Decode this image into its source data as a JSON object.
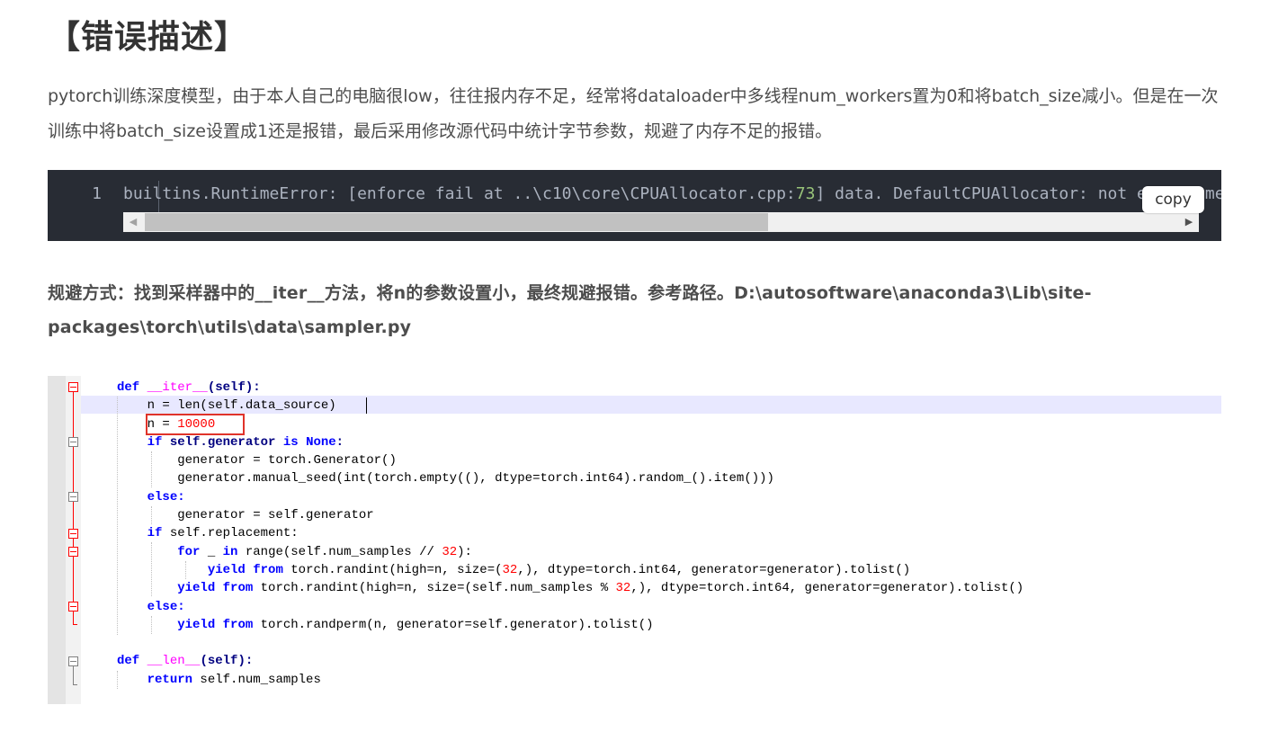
{
  "title": "【错误描述】",
  "intro": "pytorch训练深度模型，由于本人自己的电脑很low，往往报内存不足，经常将dataloader中多线程num_workers置为0和将batch_size减小。但是在一次训练中将batch_size设置成1还是报错，最后采用修改源代码中统计字节参数，规避了内存不足的报错。",
  "code_block": {
    "line_number": "1",
    "code_prefix": "builtins.RuntimeError: [enforce fail at ..\\c10\\core\\CPUAllocator.cpp:",
    "code_num": "73",
    "code_suffix": "] data. DefaultCPUAllocator: not enough memory: you tried to allocate",
    "copy_label": "copy"
  },
  "solution": "规避方式：找到采样器中的__iter__方法，将n的参数设置小，最终规避报错。参考路径。D:\\autosoftware\\anaconda3\\Lib\\site-packages\\torch\\utils\\data\\sampler.py",
  "screenshot_code": {
    "l1_def": "def",
    "l1_fn": "__iter__",
    "l1_rest": "(self):",
    "l2": "n = len(self.data_source)",
    "l3_a": "n = ",
    "l3_num": "10000",
    "l4_kw": "if",
    "l4_a": " self.generator ",
    "l4_is": "is",
    "l4_none": "None",
    "l4_b": ":",
    "l5": "generator = torch.Generator()",
    "l6": "generator.manual_seed(int(torch.empty((), dtype=torch.int64).random_().item()))",
    "l7": "else:",
    "l8": "generator = self.generator",
    "l9_kw": "if",
    "l9_rest": " self.replacement:",
    "l10_for": "for",
    "l10_a": " _ ",
    "l10_in": "in",
    "l10_b": " range(self.num_samples // ",
    "l10_num": "32",
    "l10_c": "):",
    "l11_yield": "yield",
    "l11_from": "from",
    "l11_a": " torch.randint(high=n, size=(",
    "l11_num": "32",
    "l11_b": ",), dtype=torch.int64, generator=generator).tolist()",
    "l12_yield": "yield",
    "l12_from": "from",
    "l12_a": " torch.randint(high=n, size=(self.num_samples % ",
    "l12_num": "32",
    "l12_b": ",), dtype=torch.int64, generator=generator).tolist()",
    "l13": "else:",
    "l14_yield": "yield",
    "l14_from": "from",
    "l14_a": " torch.randperm(n, generator=self.generator).tolist()",
    "l16_def": "def",
    "l16_fn": "__len__",
    "l16_rest": "(self):",
    "l17_ret": "return",
    "l17_rest": " self.num_samples"
  }
}
